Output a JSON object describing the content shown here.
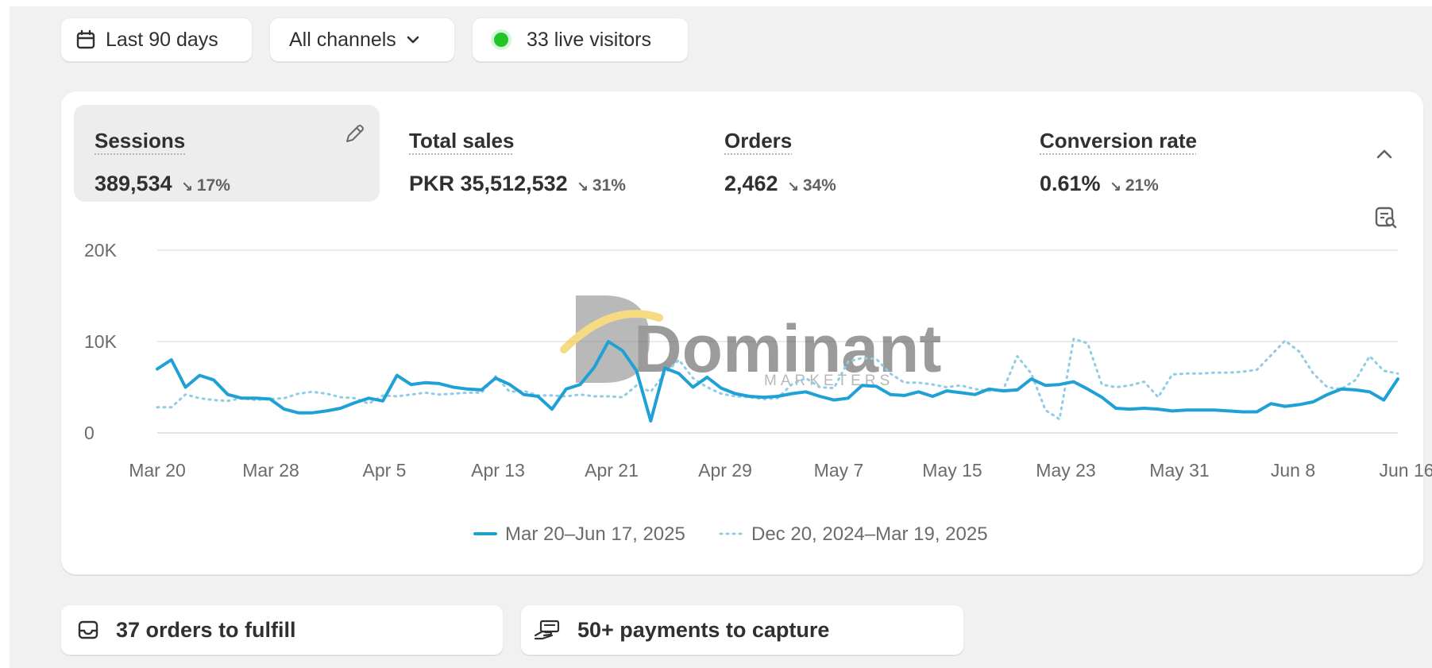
{
  "filters": {
    "date_range": "Last 90 days",
    "channels": "All channels",
    "live_visitors": "33 live visitors",
    "live_dot_color": "#22c528"
  },
  "metrics": [
    {
      "label": "Sessions",
      "value": "389,534",
      "change": "17%",
      "direction": "down",
      "active": true
    },
    {
      "label": "Total sales",
      "value": "PKR 35,512,532",
      "change": "31%",
      "direction": "down"
    },
    {
      "label": "Orders",
      "value": "2,462",
      "change": "34%",
      "direction": "down"
    },
    {
      "label": "Conversion rate",
      "value": "0.61%",
      "change": "21%",
      "direction": "down"
    }
  ],
  "watermark": {
    "main": "Dominant",
    "sub": "MARKETERS"
  },
  "chart_data": {
    "type": "line",
    "ylim": [
      0,
      20000
    ],
    "yticks": [
      "0",
      "10K",
      "20K"
    ],
    "xticks": [
      "Mar 20",
      "Mar 28",
      "Apr 5",
      "Apr 13",
      "Apr 21",
      "Apr 29",
      "May 7",
      "May 15",
      "May 23",
      "May 31",
      "Jun 8",
      "Jun 16"
    ],
    "grid": true,
    "legend_position": "bottom-center",
    "series": [
      {
        "name": "Mar 20–Jun 17, 2025",
        "style": "solid",
        "color": "#1fa1d6",
        "points": [
          [
            0,
            7000
          ],
          [
            1,
            8000
          ],
          [
            2,
            5000
          ],
          [
            3,
            6300
          ],
          [
            4,
            5800
          ],
          [
            5,
            4200
          ],
          [
            6,
            3800
          ],
          [
            7,
            3800
          ],
          [
            8,
            3700
          ],
          [
            9,
            2600
          ],
          [
            10,
            2200
          ],
          [
            11,
            2200
          ],
          [
            12,
            2400
          ],
          [
            13,
            2700
          ],
          [
            14,
            3300
          ],
          [
            15,
            3800
          ],
          [
            16,
            3500
          ],
          [
            17,
            6300
          ],
          [
            18,
            5300
          ],
          [
            19,
            5500
          ],
          [
            20,
            5400
          ],
          [
            21,
            5000
          ],
          [
            22,
            4800
          ],
          [
            23,
            4700
          ],
          [
            24,
            6000
          ],
          [
            25,
            5300
          ],
          [
            26,
            4200
          ],
          [
            27,
            4000
          ],
          [
            28,
            2600
          ],
          [
            29,
            4800
          ],
          [
            30,
            5300
          ],
          [
            31,
            7200
          ],
          [
            32,
            10000
          ],
          [
            33,
            9000
          ],
          [
            34,
            6800
          ],
          [
            35,
            1300
          ],
          [
            36,
            7100
          ],
          [
            37,
            6500
          ],
          [
            38,
            5000
          ],
          [
            39,
            6100
          ],
          [
            40,
            4900
          ],
          [
            41,
            4300
          ],
          [
            42,
            4000
          ],
          [
            43,
            3900
          ],
          [
            44,
            4000
          ],
          [
            45,
            4300
          ],
          [
            46,
            4500
          ],
          [
            47,
            4000
          ],
          [
            48,
            3600
          ],
          [
            49,
            3800
          ],
          [
            50,
            5200
          ],
          [
            51,
            5100
          ],
          [
            52,
            4200
          ],
          [
            53,
            4100
          ],
          [
            54,
            4500
          ],
          [
            55,
            4000
          ],
          [
            56,
            4600
          ],
          [
            57,
            4400
          ],
          [
            58,
            4200
          ],
          [
            59,
            4800
          ],
          [
            60,
            4600
          ],
          [
            61,
            4700
          ],
          [
            62,
            5900
          ],
          [
            63,
            5200
          ],
          [
            64,
            5300
          ],
          [
            65,
            5600
          ],
          [
            66,
            4800
          ],
          [
            67,
            3900
          ],
          [
            68,
            2700
          ],
          [
            69,
            2600
          ],
          [
            70,
            2700
          ],
          [
            71,
            2600
          ],
          [
            72,
            2400
          ],
          [
            73,
            2500
          ],
          [
            74,
            2500
          ],
          [
            75,
            2500
          ],
          [
            76,
            2400
          ],
          [
            77,
            2300
          ],
          [
            78,
            2300
          ],
          [
            79,
            3200
          ],
          [
            80,
            2900
          ],
          [
            81,
            3100
          ],
          [
            82,
            3400
          ],
          [
            83,
            4200
          ],
          [
            84,
            4800
          ],
          [
            85,
            4700
          ],
          [
            86,
            4500
          ],
          [
            87,
            3600
          ],
          [
            88,
            5900
          ]
        ]
      },
      {
        "name": "Dec 20, 2024–Mar 19, 2025",
        "style": "dotted",
        "color": "#8fcde6",
        "points": [
          [
            0,
            2800
          ],
          [
            1,
            2800
          ],
          [
            2,
            4200
          ],
          [
            3,
            3800
          ],
          [
            4,
            3600
          ],
          [
            5,
            3500
          ],
          [
            6,
            3800
          ],
          [
            7,
            3600
          ],
          [
            8,
            3700
          ],
          [
            9,
            3800
          ],
          [
            10,
            4300
          ],
          [
            11,
            4500
          ],
          [
            12,
            4300
          ],
          [
            13,
            3900
          ],
          [
            14,
            3800
          ],
          [
            15,
            3200
          ],
          [
            16,
            4100
          ],
          [
            17,
            4000
          ],
          [
            18,
            4200
          ],
          [
            19,
            4400
          ],
          [
            20,
            4200
          ],
          [
            21,
            4300
          ],
          [
            22,
            4400
          ],
          [
            23,
            4400
          ],
          [
            24,
            6200
          ],
          [
            25,
            4500
          ],
          [
            26,
            4600
          ],
          [
            27,
            4100
          ],
          [
            28,
            4100
          ],
          [
            29,
            4000
          ],
          [
            30,
            4200
          ],
          [
            31,
            4000
          ],
          [
            32,
            4000
          ],
          [
            33,
            3900
          ],
          [
            34,
            5200
          ],
          [
            35,
            4500
          ],
          [
            36,
            6500
          ],
          [
            37,
            8000
          ],
          [
            38,
            6000
          ],
          [
            39,
            5000
          ],
          [
            40,
            4300
          ],
          [
            41,
            4000
          ],
          [
            42,
            3900
          ],
          [
            43,
            3700
          ],
          [
            44,
            3800
          ],
          [
            45,
            5300
          ],
          [
            46,
            6000
          ],
          [
            47,
            5000
          ],
          [
            48,
            4900
          ],
          [
            49,
            7800
          ],
          [
            50,
            8200
          ],
          [
            51,
            8100
          ],
          [
            52,
            6500
          ],
          [
            53,
            5500
          ],
          [
            54,
            5500
          ],
          [
            55,
            5300
          ],
          [
            56,
            5000
          ],
          [
            57,
            5200
          ],
          [
            58,
            4800
          ],
          [
            59,
            4600
          ],
          [
            60,
            4700
          ],
          [
            61,
            8400
          ],
          [
            62,
            6500
          ],
          [
            63,
            2500
          ],
          [
            64,
            1500
          ],
          [
            65,
            10300
          ],
          [
            66,
            9800
          ],
          [
            67,
            5300
          ],
          [
            68,
            5000
          ],
          [
            69,
            5200
          ],
          [
            70,
            5600
          ],
          [
            71,
            3900
          ],
          [
            72,
            6400
          ],
          [
            73,
            6500
          ],
          [
            74,
            6500
          ],
          [
            75,
            6600
          ],
          [
            76,
            6600
          ],
          [
            77,
            6700
          ],
          [
            78,
            6900
          ],
          [
            79,
            8500
          ],
          [
            80,
            10100
          ],
          [
            81,
            8900
          ],
          [
            82,
            6500
          ],
          [
            83,
            5000
          ],
          [
            84,
            4800
          ],
          [
            85,
            5800
          ],
          [
            86,
            8400
          ],
          [
            87,
            6800
          ],
          [
            88,
            6500
          ]
        ]
      }
    ]
  },
  "tasks": [
    {
      "label": "37 orders to fulfill"
    },
    {
      "label": "50+ payments to capture"
    }
  ]
}
